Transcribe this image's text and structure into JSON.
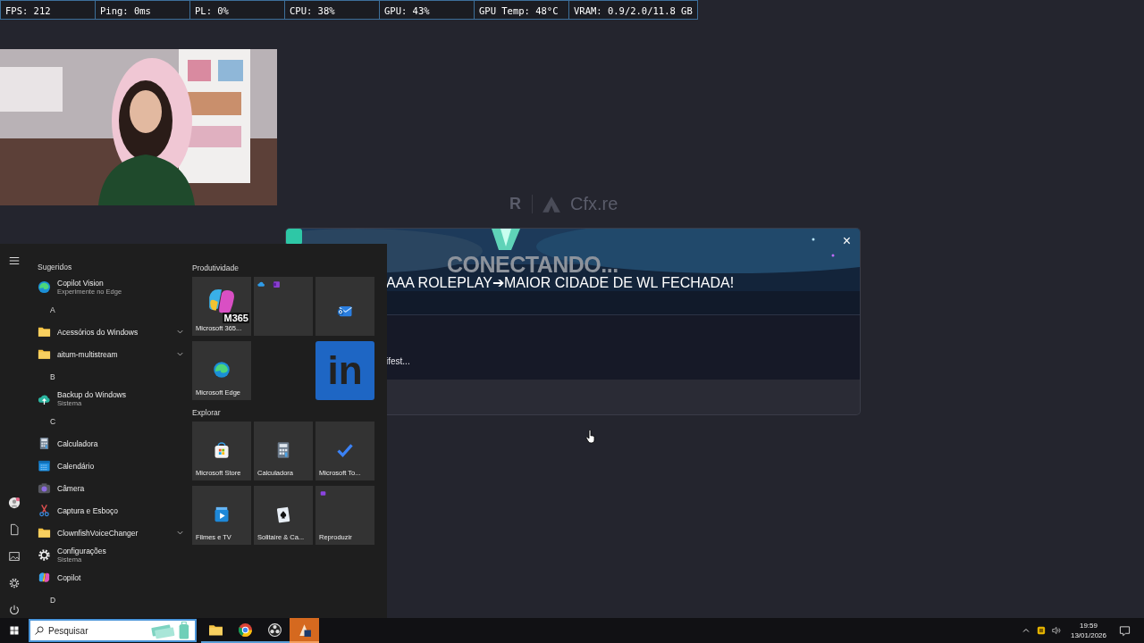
{
  "stats": [
    "FPS: 212",
    "Ping: 0ms",
    "PL: 0%",
    "CPU: 38%",
    "GPU: 43%",
    "GPU Temp: 48°C",
    "VRAM: 0.9/2.0/11.8 GB"
  ],
  "background_logo": {
    "mark": "R",
    "name": "Cfx.re"
  },
  "dialog": {
    "banner": "CONECTANDO...",
    "title": "AAA ROLEPLAY➔MAIOR CIDADE DE WL FECHADA!",
    "status": "ifest...",
    "close": "×"
  },
  "start_menu": {
    "heading": "Sugeridos",
    "items": [
      {
        "kind": "app",
        "name": "Copilot Vision",
        "subtitle": "Experimente no Edge"
      },
      {
        "kind": "letter",
        "name": "A"
      },
      {
        "kind": "folder",
        "name": "Acessórios do Windows"
      },
      {
        "kind": "folder",
        "name": "aitum-multistream"
      },
      {
        "kind": "letter",
        "name": "B"
      },
      {
        "kind": "app",
        "name": "Backup do Windows",
        "subtitle": "Sistema"
      },
      {
        "kind": "letter",
        "name": "C"
      },
      {
        "kind": "app",
        "name": "Calculadora"
      },
      {
        "kind": "app",
        "name": "Calendário"
      },
      {
        "kind": "app",
        "name": "Câmera"
      },
      {
        "kind": "app",
        "name": "Captura e Esboço"
      },
      {
        "kind": "folder",
        "name": "ClownfishVoiceChanger"
      },
      {
        "kind": "app",
        "name": "Configurações",
        "subtitle": "Sistema"
      },
      {
        "kind": "app",
        "name": "Copilot"
      },
      {
        "kind": "letter",
        "name": "D"
      }
    ],
    "tile_groups": [
      {
        "heading": "Produtividade",
        "tiles": [
          {
            "kind": "app",
            "label": "Microsoft 365...",
            "badge": "M365"
          },
          {
            "kind": "icons"
          },
          {
            "kind": "icons"
          },
          {
            "kind": "app",
            "label": "Microsoft Edge"
          },
          {
            "kind": "gap"
          },
          {
            "kind": "brand",
            "text": "in"
          }
        ]
      },
      {
        "heading": "Explorar",
        "tiles": [
          {
            "kind": "app",
            "label": "Microsoft Store"
          },
          {
            "kind": "app",
            "label": "Calculadora"
          },
          {
            "kind": "app",
            "label": "Microsoft To..."
          },
          {
            "kind": "app",
            "label": "Filmes e TV"
          },
          {
            "kind": "app",
            "label": "Solitaire & Ca..."
          },
          {
            "kind": "app",
            "label": "Reproduzir"
          }
        ]
      }
    ]
  },
  "taskbar": {
    "search": {
      "placeholder": "Pesquisar"
    },
    "apps": [
      {
        "selected": false
      },
      {
        "selected": false
      },
      {
        "selected": false
      },
      {
        "selected": true
      }
    ],
    "clock": {
      "time": "19:59",
      "date": "13/01/2026"
    }
  }
}
